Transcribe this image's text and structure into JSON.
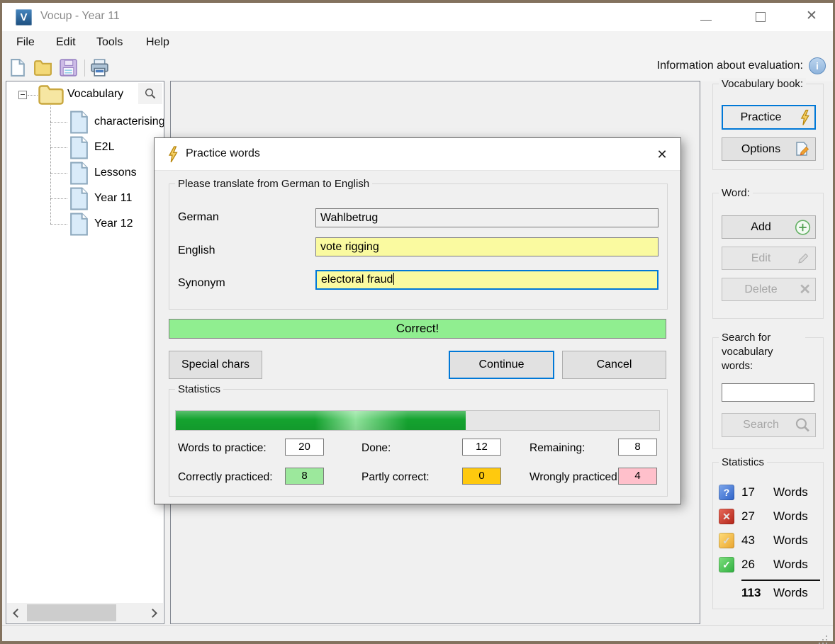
{
  "window": {
    "logo_letter": "V",
    "title": "Vocup - Year 11",
    "menu": [
      "File",
      "Edit",
      "Tools",
      "Help"
    ],
    "info_label": "Information about evaluation:"
  },
  "tree": {
    "root_label": "Vocabulary",
    "items": [
      "characterising",
      "E2L",
      "Lessons",
      "Year 11",
      "Year 12"
    ]
  },
  "sidebar": {
    "vocabulary_book": {
      "title": "Vocabulary book:",
      "practice_label": "Practice",
      "options_label": "Options"
    },
    "word": {
      "title": "Word:",
      "add_label": "Add",
      "edit_label": "Edit",
      "delete_label": "Delete"
    },
    "search": {
      "title": "Search for vocabulary words:",
      "input_value": "",
      "button_label": "Search"
    },
    "statistics": {
      "title": "Statistics",
      "rows": [
        {
          "icon": "question-mark",
          "count": "17",
          "unit": "Words"
        },
        {
          "icon": "wrong-cross",
          "count": "27",
          "unit": "Words"
        },
        {
          "icon": "partly-check",
          "count": "43",
          "unit": "Words"
        },
        {
          "icon": "correct-check",
          "count": "26",
          "unit": "Words"
        }
      ],
      "total_count": "113",
      "total_unit": "Words"
    }
  },
  "dialog": {
    "title": "Practice words",
    "group_title": "Please translate from German to English",
    "fields": [
      {
        "label": "German",
        "value": "Wahlbetrug",
        "state": "readonly"
      },
      {
        "label": "English",
        "value": "vote rigging",
        "state": "answered"
      },
      {
        "label": "Synonym",
        "value": "electoral fraud",
        "state": "focused"
      }
    ],
    "result_text": "Correct!",
    "special_chars_label": "Special chars",
    "continue_label": "Continue",
    "cancel_label": "Cancel",
    "statistics": {
      "title": "Statistics",
      "progress_percent": 60,
      "stats": [
        {
          "label": "Words to practice:",
          "value": "20",
          "color": "box_white"
        },
        {
          "label": "Done:",
          "value": "12",
          "color": "box_white"
        },
        {
          "label": "Remaining:",
          "value": "8",
          "color": "box_white"
        },
        {
          "label": "Correctly practiced:",
          "value": "8",
          "color": "box_green"
        },
        {
          "label": "Partly correct:",
          "value": "0",
          "color": "box_gold"
        },
        {
          "label": "Wrongly practiced:",
          "value": "4",
          "color": "box_pink"
        }
      ]
    }
  },
  "colors": {
    "accent": "#0078D7",
    "field_yellow": "#FAFAA0",
    "correct_green": "#90EE90",
    "progress_green": "#14A32F",
    "box_white": "#FFFFFF",
    "box_green": "#9CE89C",
    "box_gold": "#FFC90E",
    "box_pink": "#FFC0CB"
  }
}
